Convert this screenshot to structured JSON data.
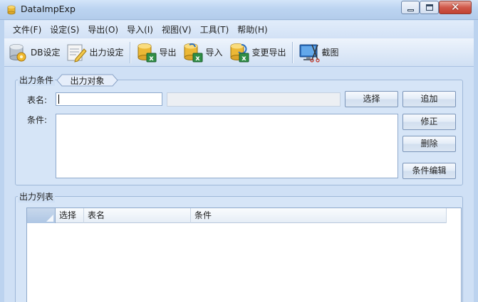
{
  "window": {
    "title": "DataImpExp"
  },
  "menu": [
    {
      "label": "文件(F)"
    },
    {
      "label": "设定(S)"
    },
    {
      "label": "导出(O)"
    },
    {
      "label": "导入(I)"
    },
    {
      "label": "视图(V)"
    },
    {
      "label": "工具(T)"
    },
    {
      "label": "帮助(H)"
    }
  ],
  "toolbar": {
    "db_settings": "DB设定",
    "output_settings": "出力设定",
    "export": "导出",
    "import": "导入",
    "diff_export": "变更导出",
    "screenshot": "截图"
  },
  "conditions": {
    "group_title": "出力条件",
    "tab_label": "出力对象",
    "table_name_label": "表名:",
    "table_name_value": "",
    "condition_label": "条件:",
    "condition_value": "",
    "select_button": "选择",
    "add_button": "追加",
    "modify_button": "修正",
    "delete_button": "删除",
    "edit_button": "条件编辑"
  },
  "output_list": {
    "group_title": "出力列表",
    "columns": [
      "选择",
      "表名",
      "条件"
    ],
    "rows": []
  },
  "colors": {
    "frame_bg": "#cfe0f5",
    "panel_border": "#9fb8d8",
    "close_button": "#c14232"
  }
}
